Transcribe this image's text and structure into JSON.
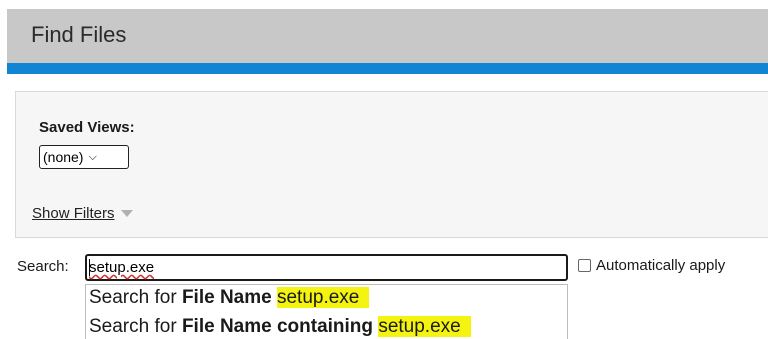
{
  "header": {
    "title": "Find Files"
  },
  "filters": {
    "saved_views_label": "Saved Views:",
    "saved_views_selected": "(none)",
    "show_filters_label": "Show Filters"
  },
  "search": {
    "label": "Search:",
    "value": "setup.exe",
    "auto_apply_label": "Automatically apply"
  },
  "suggestions": [
    {
      "prefix": "Search for ",
      "field": "File Name",
      "value": "setup.exe"
    },
    {
      "prefix": "Search for ",
      "field": "File Name containing",
      "value": "setup.exe"
    }
  ],
  "colors": {
    "title_bar_bg": "#c8c8c8",
    "accent_bar": "#0f85d3",
    "highlight": "#f4f410"
  }
}
